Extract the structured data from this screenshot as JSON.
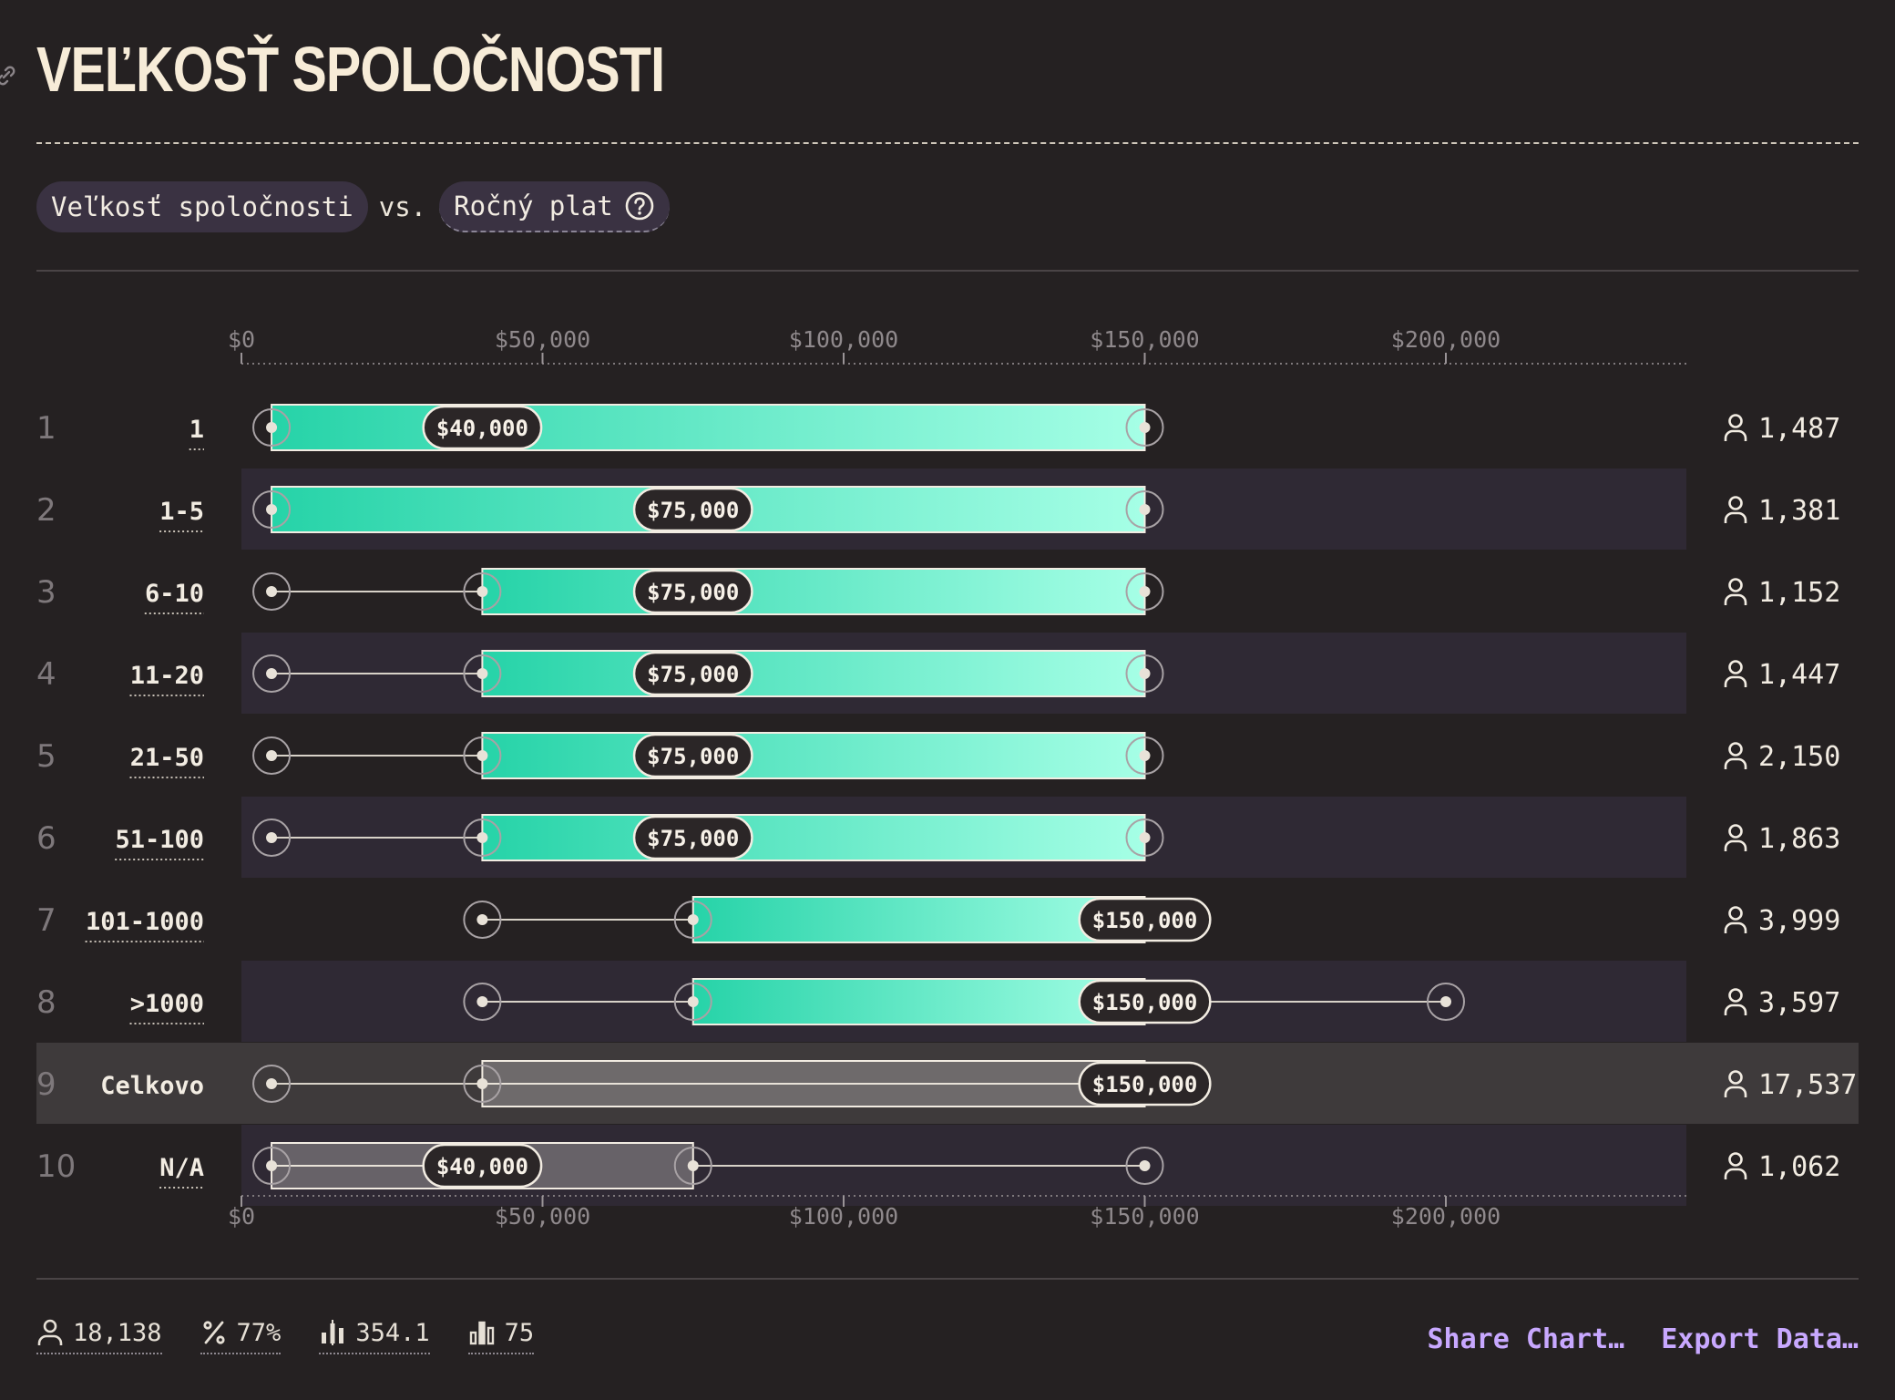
{
  "title": "VEĽKOSŤ SPOLOČNOSTI",
  "chips": {
    "left": "Veľkosť spoločnosti",
    "vs": "vs.",
    "right": "Ročný plat"
  },
  "colors": {
    "background": "#252122",
    "row_stripe": "#2f2934",
    "highlight_row": "#3e3a3b",
    "bar_start": "#26d3a8",
    "bar_end": "#a6ffe6",
    "link": "#c8a8ff"
  },
  "chart_data": {
    "type": "bar",
    "subtype": "range (box) bar per category",
    "x_axis": {
      "ticks": [
        "$0",
        "$50,000",
        "$100,000",
        "$150,000",
        "$200,000"
      ],
      "tick_values": [
        0,
        50000,
        100000,
        150000,
        200000
      ],
      "range": [
        0,
        240000
      ],
      "shown_top_and_bottom": true
    },
    "rows": [
      {
        "rank": "1",
        "category": "1",
        "min": 5000,
        "q1": 5000,
        "median": 40000,
        "q3": 150000,
        "max": 150000,
        "count": "1,487",
        "highlight": false
      },
      {
        "rank": "2",
        "category": "1-5",
        "min": 5000,
        "q1": 5000,
        "median": 75000,
        "q3": 150000,
        "max": 150000,
        "count": "1,381",
        "highlight": false
      },
      {
        "rank": "3",
        "category": "6-10",
        "min": 5000,
        "q1": 40000,
        "median": 75000,
        "q3": 150000,
        "max": 150000,
        "count": "1,152",
        "highlight": false
      },
      {
        "rank": "4",
        "category": "11-20",
        "min": 5000,
        "q1": 40000,
        "median": 75000,
        "q3": 150000,
        "max": 150000,
        "count": "1,447",
        "highlight": false
      },
      {
        "rank": "5",
        "category": "21-50",
        "min": 5000,
        "q1": 40000,
        "median": 75000,
        "q3": 150000,
        "max": 150000,
        "count": "2,150",
        "highlight": false
      },
      {
        "rank": "6",
        "category": "51-100",
        "min": 5000,
        "q1": 40000,
        "median": 75000,
        "q3": 150000,
        "max": 150000,
        "count": "1,863",
        "highlight": false
      },
      {
        "rank": "7",
        "category": "101-1000",
        "min": 40000,
        "q1": 75000,
        "median": 150000,
        "q3": 150000,
        "max": 150000,
        "count": "3,999",
        "highlight": false
      },
      {
        "rank": "8",
        "category": ">1000",
        "min": 40000,
        "q1": 75000,
        "median": 150000,
        "q3": 150000,
        "max": 200000,
        "count": "3,597",
        "highlight": false
      },
      {
        "rank": "9",
        "category": "Celkovo",
        "min": 5000,
        "q1": 40000,
        "median": 150000,
        "q3": 150000,
        "max": 150000,
        "count": "17,537",
        "highlight": true,
        "neutral": true
      },
      {
        "rank": "10",
        "category": "N/A",
        "min": 5000,
        "q1": 5000,
        "median": 40000,
        "q3": 75000,
        "max": 150000,
        "count": "1,062",
        "highlight": false,
        "neutral": true
      }
    ],
    "median_labels": [
      "$40,000",
      "$75,000",
      "$75,000",
      "$75,000",
      "$75,000",
      "$75,000",
      "$150,000",
      "$150,000",
      "$150,000",
      "$40,000"
    ],
    "legend": "none",
    "grid": false
  },
  "stats": [
    {
      "icon": "person-icon",
      "value": "18,138"
    },
    {
      "icon": "percent-icon",
      "value": "77%"
    },
    {
      "icon": "candlestick-icon",
      "value": "354.1"
    },
    {
      "icon": "bar-chart-icon",
      "value": "75"
    }
  ],
  "actions": {
    "share": "Share Chart…",
    "export": "Export Data…"
  }
}
